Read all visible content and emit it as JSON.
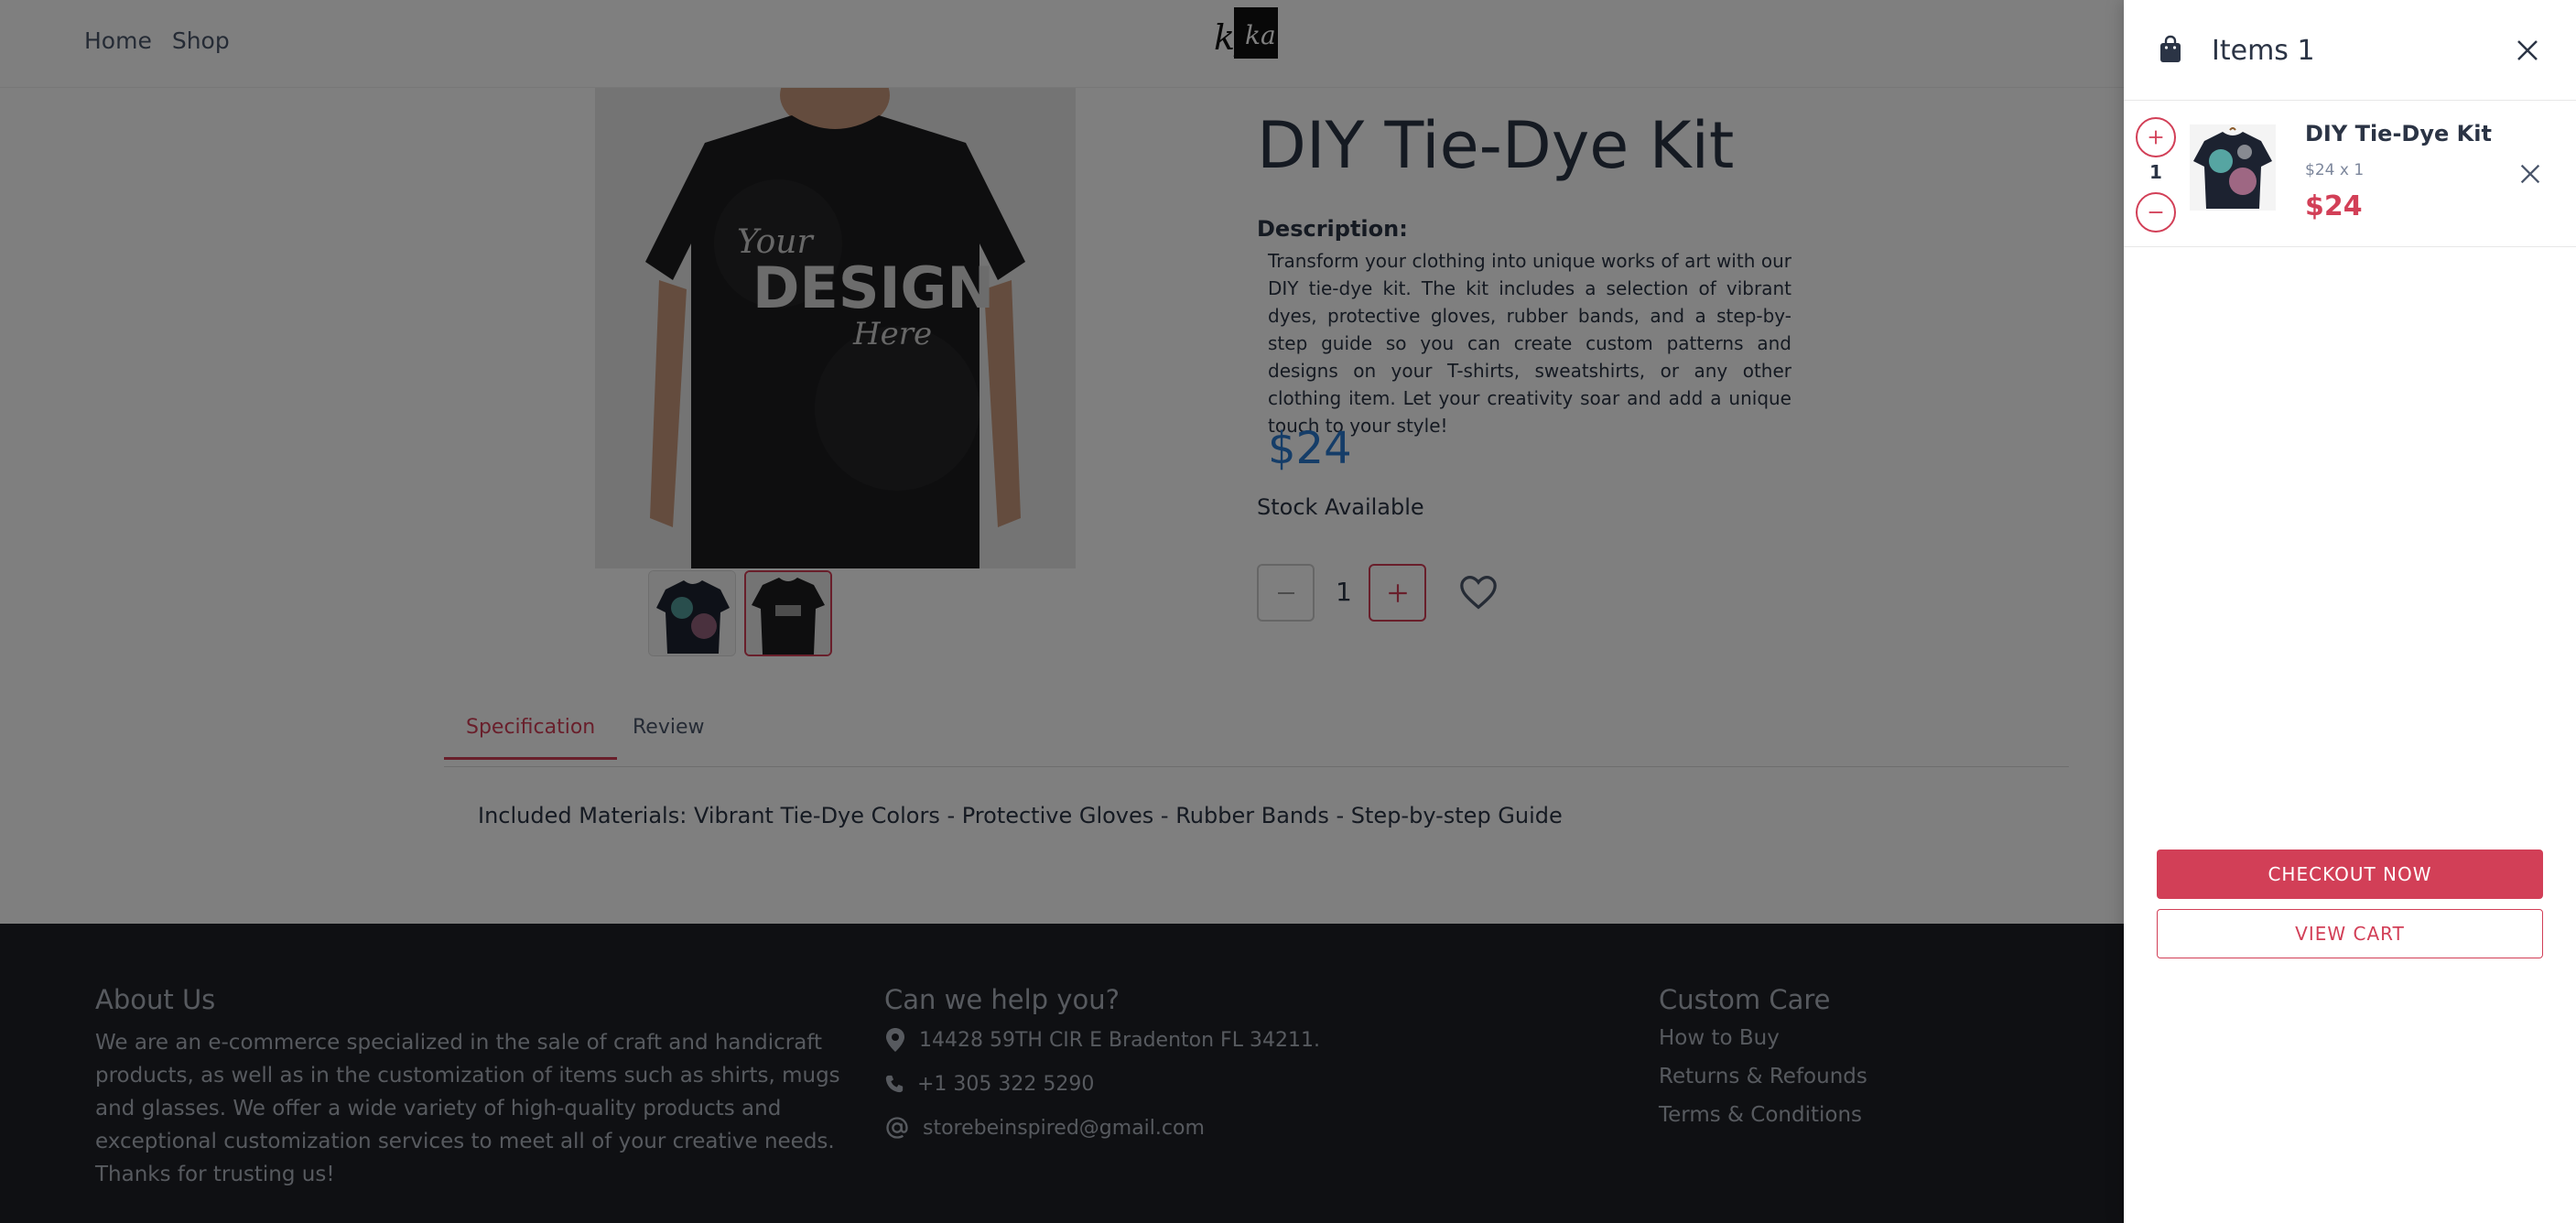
{
  "header": {
    "nav": [
      {
        "label": "Home"
      },
      {
        "label": "Shop"
      }
    ],
    "logo_text": "kyka"
  },
  "product": {
    "title": "DIY Tie-Dye Kit",
    "description_label": "Description:",
    "description": "Transform your clothing into unique works of art with our DIY tie-dye kit. The kit includes a selection of vibrant dyes, protective gloves, rubber bands, and a step-by-step guide so you can create custom patterns and designs on your T-shirts, sweatshirts, or any other clothing item. Let your creativity soar and add a unique touch to your style!",
    "price": "$24",
    "stock": "Stock Available",
    "quantity": "1",
    "image_text": [
      "Your",
      "DESIGN",
      "Here"
    ]
  },
  "tabs": [
    {
      "label": "Specification"
    },
    {
      "label": "Review"
    }
  ],
  "specification": "Included Materials: Vibrant Tie-Dye Colors - Protective Gloves - Rubber Bands - Step-by-step Guide",
  "footer": {
    "about_title": "About Us",
    "about_text": "We are an e-commerce specialized in the sale of craft and handicraft products, as well as in the customization of items such as shirts, mugs and glasses. We offer a wide variety of high-quality products and exceptional customization services to meet all of your creative needs. Thanks for trusting us!",
    "help_title": "Can we help you?",
    "address": "14428 59TH CIR E Bradenton FL 34211.",
    "phone": "+1 305 322 5290",
    "email": "storebeinspired@gmail.com",
    "care_title": "Custom Care",
    "care_links": [
      {
        "label": "How to Buy"
      },
      {
        "label": "Returns & Refounds"
      },
      {
        "label": "Terms & Conditions"
      }
    ]
  },
  "cart": {
    "title": "Items 1",
    "item": {
      "qty": "1",
      "name": "DIY Tie-Dye Kit",
      "subtitle": "$24 x 1",
      "price": "$24"
    },
    "checkout_label": "CHECKOUT NOW",
    "view_cart_label": "VIEW CART"
  },
  "colors": {
    "accent": "#d23f57",
    "price_blue": "#2a7ad1",
    "footer_bg": "#1e2026"
  }
}
